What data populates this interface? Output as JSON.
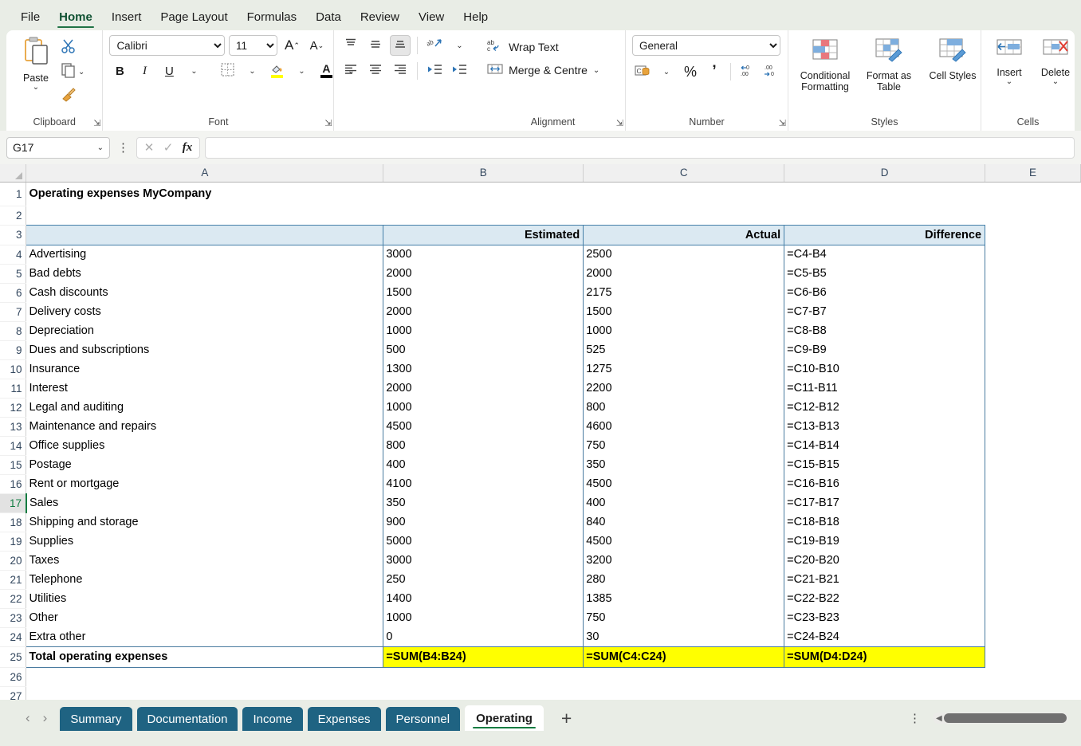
{
  "ribbon": {
    "tabs": [
      {
        "label": "File",
        "active": false
      },
      {
        "label": "Home",
        "active": true
      },
      {
        "label": "Insert",
        "active": false
      },
      {
        "label": "Page Layout",
        "active": false
      },
      {
        "label": "Formulas",
        "active": false
      },
      {
        "label": "Data",
        "active": false
      },
      {
        "label": "Review",
        "active": false
      },
      {
        "label": "View",
        "active": false
      },
      {
        "label": "Help",
        "active": false
      }
    ],
    "clipboard": {
      "group_label": "Clipboard",
      "paste_label": "Paste",
      "cut_icon": "scissors-icon",
      "copy_icon": "copy-icon",
      "format_painter_icon": "format-painter-icon"
    },
    "font": {
      "group_label": "Font",
      "font_name": "Calibri",
      "font_size": "11",
      "grow_font": "A",
      "shrink_font": "A",
      "bold": "B",
      "italic": "I",
      "underline": "U",
      "borders_icon": "borders-icon",
      "fill_color_icon": "fill-color-icon",
      "font_color_icon": "font-color-icon",
      "fill_color": "#ffff00",
      "font_color": "#000000"
    },
    "alignment": {
      "group_label": "Alignment",
      "wrap_text": "Wrap Text",
      "merge_centre": "Merge & Centre",
      "top_align_icon": "align-top-icon",
      "middle_align_icon": "align-middle-icon",
      "bottom_align_icon": "align-bottom-icon",
      "orientation_icon": "text-orientation-icon",
      "align_left_icon": "align-left-icon",
      "align_center_icon": "align-center-icon",
      "align_right_icon": "align-right-icon",
      "decrease_indent_icon": "decrease-indent-icon",
      "increase_indent_icon": "increase-indent-icon"
    },
    "number": {
      "group_label": "Number",
      "format": "General",
      "accounting_icon": "accounting-format-icon",
      "percent": "%",
      "comma": "’",
      "increase_decimal_icon": "increase-decimal-icon",
      "decrease_decimal_icon": "decrease-decimal-icon"
    },
    "styles": {
      "group_label": "Styles",
      "conditional_formatting": "Conditional Formatting",
      "format_as_table": "Format as Table",
      "cell_styles": "Cell Styles"
    },
    "cells": {
      "group_label": "Cells",
      "insert": "Insert",
      "delete": "Delete"
    }
  },
  "formula_bar": {
    "name_box": "G17",
    "formula_value": "",
    "cancel_icon": "cancel-icon",
    "enter_icon": "enter-icon",
    "function_icon": "insert-function-icon"
  },
  "grid": {
    "columns": [
      "A",
      "B",
      "C",
      "D",
      "E"
    ],
    "row_numbers": [
      "1",
      "2",
      "3",
      "4",
      "5",
      "6",
      "7",
      "8",
      "9",
      "10",
      "11",
      "12",
      "13",
      "14",
      "15",
      "16",
      "17",
      "18",
      "19",
      "20",
      "21",
      "22",
      "23",
      "24",
      "25",
      "26",
      "27"
    ],
    "selected_row": "17",
    "title": "Operating expenses MyCompany",
    "headers": {
      "a": "",
      "estimated": "Estimated",
      "actual": "Actual",
      "difference": "Difference"
    },
    "rows": [
      {
        "row": "4",
        "name": "Advertising",
        "estimated": "3000",
        "actual": "2500",
        "difference": "=C4-B4"
      },
      {
        "row": "5",
        "name": "Bad debts",
        "estimated": "2000",
        "actual": "2000",
        "difference": "=C5-B5"
      },
      {
        "row": "6",
        "name": "Cash discounts",
        "estimated": "1500",
        "actual": "2175",
        "difference": "=C6-B6"
      },
      {
        "row": "7",
        "name": "Delivery costs",
        "estimated": "2000",
        "actual": "1500",
        "difference": "=C7-B7"
      },
      {
        "row": "8",
        "name": "Depreciation",
        "estimated": "1000",
        "actual": "1000",
        "difference": "=C8-B8"
      },
      {
        "row": "9",
        "name": "Dues and subscriptions",
        "estimated": "500",
        "actual": "525",
        "difference": "=C9-B9"
      },
      {
        "row": "10",
        "name": "Insurance",
        "estimated": "1300",
        "actual": "1275",
        "difference": "=C10-B10"
      },
      {
        "row": "11",
        "name": "Interest",
        "estimated": "2000",
        "actual": "2200",
        "difference": "=C11-B11"
      },
      {
        "row": "12",
        "name": "Legal and auditing",
        "estimated": "1000",
        "actual": "800",
        "difference": "=C12-B12"
      },
      {
        "row": "13",
        "name": "Maintenance and repairs",
        "estimated": "4500",
        "actual": "4600",
        "difference": "=C13-B13"
      },
      {
        "row": "14",
        "name": "Office supplies",
        "estimated": "800",
        "actual": "750",
        "difference": "=C14-B14"
      },
      {
        "row": "15",
        "name": "Postage",
        "estimated": "400",
        "actual": "350",
        "difference": "=C15-B15"
      },
      {
        "row": "16",
        "name": "Rent or mortgage",
        "estimated": "4100",
        "actual": "4500",
        "difference": "=C16-B16"
      },
      {
        "row": "17",
        "name": "Sales",
        "estimated": "350",
        "actual": "400",
        "difference": "=C17-B17"
      },
      {
        "row": "18",
        "name": "Shipping and storage",
        "estimated": "900",
        "actual": "840",
        "difference": "=C18-B18"
      },
      {
        "row": "19",
        "name": "Supplies",
        "estimated": "5000",
        "actual": "4500",
        "difference": "=C19-B19"
      },
      {
        "row": "20",
        "name": "Taxes",
        "estimated": "3000",
        "actual": "3200",
        "difference": "=C20-B20"
      },
      {
        "row": "21",
        "name": "Telephone",
        "estimated": "250",
        "actual": "280",
        "difference": "=C21-B21"
      },
      {
        "row": "22",
        "name": "Utilities",
        "estimated": "1400",
        "actual": "1385",
        "difference": "=C22-B22"
      },
      {
        "row": "23",
        "name": "Other",
        "estimated": "1000",
        "actual": "750",
        "difference": "=C23-B23"
      },
      {
        "row": "24",
        "name": "Extra other",
        "estimated": "0",
        "actual": "30",
        "difference": "=C24-B24"
      }
    ],
    "total": {
      "row": "25",
      "name": "Total operating expenses",
      "estimated": "=SUM(B4:B24)",
      "actual": "=SUM(C4:C24)",
      "difference": "=SUM(D4:D24)"
    },
    "highlight_color": "#ffff00",
    "header_fill": "#dbe9f2",
    "title_color": "#1f4e79"
  },
  "sheet_tabs": {
    "prev_icon": "previous-sheet-icon",
    "next_icon": "next-sheet-icon",
    "tabs": [
      {
        "label": "Summary",
        "active": false
      },
      {
        "label": "Documentation",
        "active": false
      },
      {
        "label": "Income",
        "active": false
      },
      {
        "label": "Expenses",
        "active": false
      },
      {
        "label": "Personnel",
        "active": false
      },
      {
        "label": "Operating",
        "active": true
      }
    ],
    "add_sheet": "+",
    "overflow_icon": "more-options-icon",
    "scrollbar_icon": "horizontal-scrollbar"
  }
}
